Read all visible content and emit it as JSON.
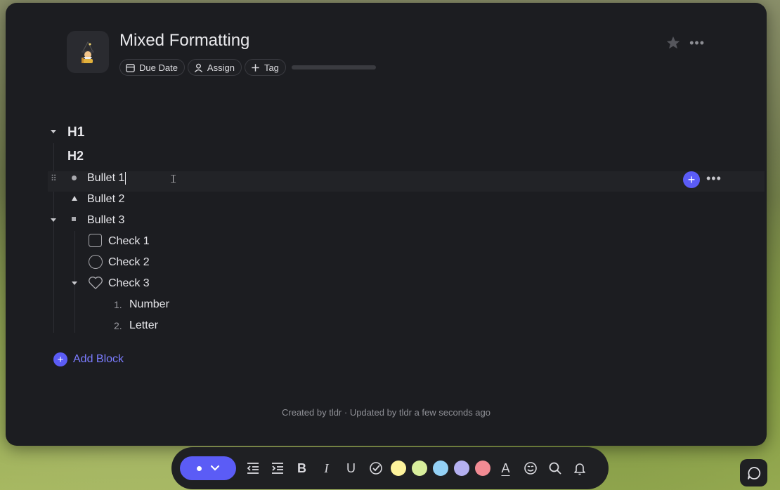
{
  "page": {
    "title": "Mixed Formatting",
    "emoji": "🧙",
    "chips": {
      "due_date": "Due Date",
      "assign": "Assign",
      "tag": "Tag"
    },
    "progress": 0.0,
    "more": "•••"
  },
  "blocks": {
    "h1": "H1",
    "h2": "H2",
    "bullet1": "Bullet 1",
    "bullet2": "Bullet 2",
    "bullet3": "Bullet 3",
    "check1": "Check 1",
    "check2": "Check 2",
    "check3": "Check 3",
    "number_marker1": "1.",
    "number_text": "Number",
    "number_marker2": "2.",
    "letter_text": "Letter",
    "row_more": "•••",
    "plus": "+"
  },
  "add_block": "Add Block",
  "footer": "Created by tldr · Updated by tldr a few seconds ago",
  "toolbar": {
    "swatches": [
      "#fdf39c",
      "#d8ee9c",
      "#94d1f5",
      "#b4b0f0",
      "#f28b93"
    ],
    "accent": "#5b5cf6",
    "text_color_label": "A"
  }
}
